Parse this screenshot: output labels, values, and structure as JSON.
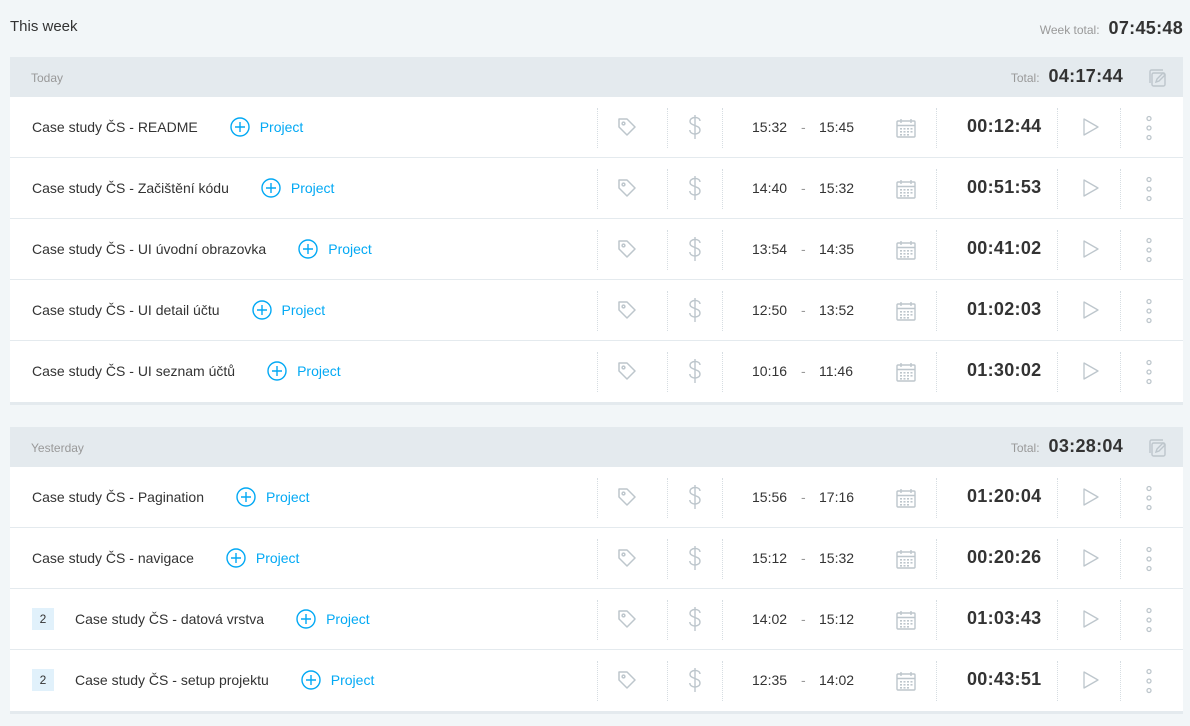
{
  "week": {
    "title": "This week",
    "total_label": "Week total:",
    "total": "07:45:48"
  },
  "days": [
    {
      "label": "Today",
      "total_label": "Total:",
      "total": "04:17:44",
      "entries": [
        {
          "badge": "",
          "description": "Case study ČS - README",
          "project": "Project",
          "start": "15:32",
          "end": "15:45",
          "duration": "00:12:44"
        },
        {
          "badge": "",
          "description": "Case study ČS - Začištění kódu",
          "project": "Project",
          "start": "14:40",
          "end": "15:32",
          "duration": "00:51:53"
        },
        {
          "badge": "",
          "description": "Case study ČS - UI úvodní obrazovka",
          "project": "Project",
          "start": "13:54",
          "end": "14:35",
          "duration": "00:41:02"
        },
        {
          "badge": "",
          "description": "Case study ČS - UI detail účtu",
          "project": "Project",
          "start": "12:50",
          "end": "13:52",
          "duration": "01:02:03"
        },
        {
          "badge": "",
          "description": "Case study ČS - UI seznam účtů",
          "project": "Project",
          "start": "10:16",
          "end": "11:46",
          "duration": "01:30:02"
        }
      ]
    },
    {
      "label": "Yesterday",
      "total_label": "Total:",
      "total": "03:28:04",
      "entries": [
        {
          "badge": "",
          "description": "Case study ČS - Pagination",
          "project": "Project",
          "start": "15:56",
          "end": "17:16",
          "duration": "01:20:04"
        },
        {
          "badge": "",
          "description": "Case study ČS - navigace",
          "project": "Project",
          "start": "15:12",
          "end": "15:32",
          "duration": "00:20:26"
        },
        {
          "badge": "2",
          "description": "Case study ČS - datová vrstva",
          "project": "Project",
          "start": "14:02",
          "end": "15:12",
          "duration": "01:03:43"
        },
        {
          "badge": "2",
          "description": "Case study ČS - setup projektu",
          "project": "Project",
          "start": "12:35",
          "end": "14:02",
          "duration": "00:43:51"
        }
      ]
    }
  ],
  "time_separator": "-",
  "icons": {
    "project": "plus-circle-icon",
    "tag": "tag-icon",
    "billable": "dollar-icon",
    "date": "calendar-icon",
    "continue": "play-icon",
    "more": "kebab-menu-icon",
    "bulk": "bulk-edit-icon"
  },
  "colors": {
    "accent": "#03a9f4",
    "header_bg": "#e4eaee",
    "page_bg": "#f2f6f8",
    "badge_bg": "#e1f1fb",
    "icon": "#bdc6cc"
  }
}
